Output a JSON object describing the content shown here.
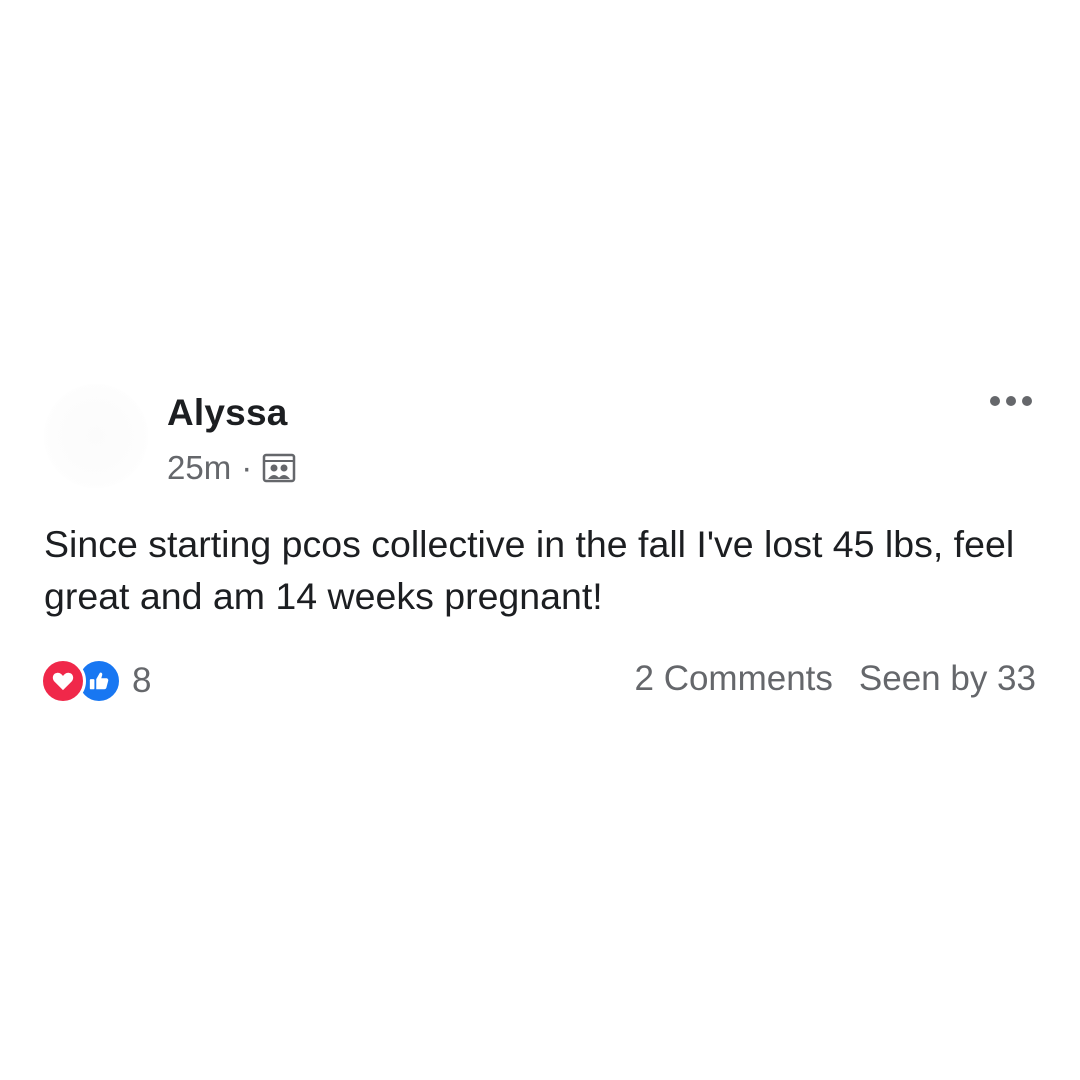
{
  "post": {
    "author": "Alyssa",
    "timestamp": "25m",
    "separator": "·",
    "audience_icon": "group-members-icon",
    "text": "Since starting pcos collective in the fall I've lost 45 lbs, feel great and am 14 weeks pregnant!",
    "reactions": {
      "types": [
        "love",
        "like"
      ],
      "count": "8"
    },
    "comments_label": "2 Comments",
    "seen_by_label": "Seen by 33"
  },
  "colors": {
    "text_primary": "#1c1e21",
    "text_secondary": "#65676b",
    "love": "#f0284a",
    "like": "#1877f2"
  }
}
